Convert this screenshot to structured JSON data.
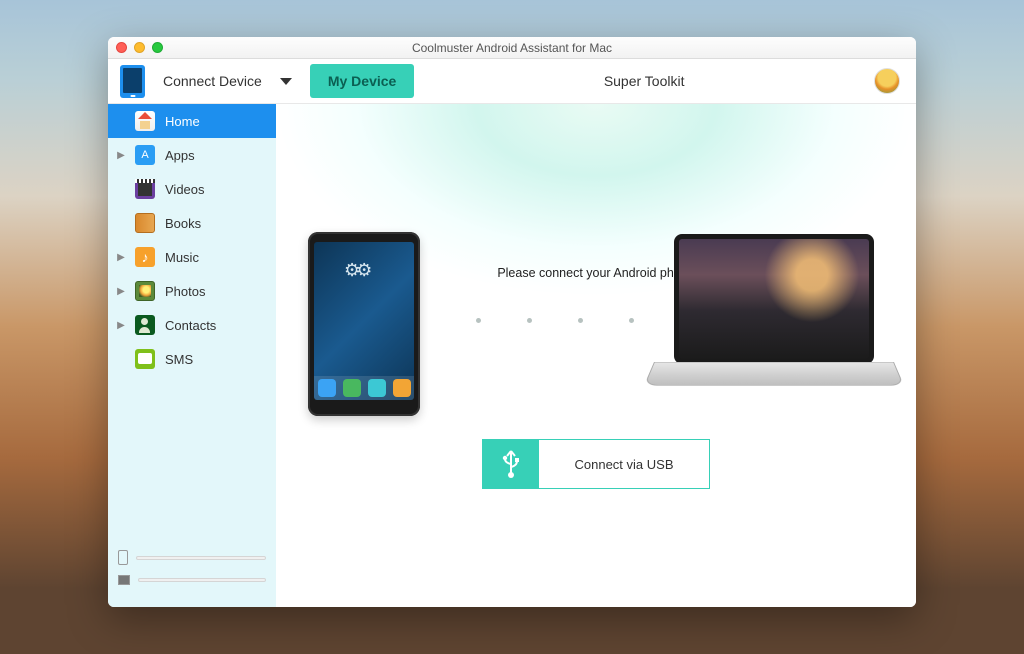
{
  "window": {
    "title": "Coolmuster Android Assistant for Mac"
  },
  "toolbar": {
    "connect_device": "Connect Device",
    "my_device": "My Device",
    "super_toolkit": "Super Toolkit"
  },
  "sidebar": {
    "items": [
      {
        "label": "Home",
        "icon": "home-icon",
        "expandable": false,
        "active": true
      },
      {
        "label": "Apps",
        "icon": "apps-icon",
        "expandable": true,
        "active": false
      },
      {
        "label": "Videos",
        "icon": "videos-icon",
        "expandable": false,
        "active": false
      },
      {
        "label": "Books",
        "icon": "books-icon",
        "expandable": false,
        "active": false
      },
      {
        "label": "Music",
        "icon": "music-icon",
        "expandable": true,
        "active": false
      },
      {
        "label": "Photos",
        "icon": "photos-icon",
        "expandable": true,
        "active": false
      },
      {
        "label": "Contacts",
        "icon": "contacts-icon",
        "expandable": true,
        "active": false
      },
      {
        "label": "SMS",
        "icon": "sms-icon",
        "expandable": false,
        "active": false
      }
    ]
  },
  "main": {
    "prompt": "Please connect your Android phone",
    "connect_label": "Connect via USB"
  },
  "colors": {
    "accent": "#37d0b7",
    "primary_blue": "#1d8fee",
    "sidebar_bg": "#e3f7fa"
  }
}
